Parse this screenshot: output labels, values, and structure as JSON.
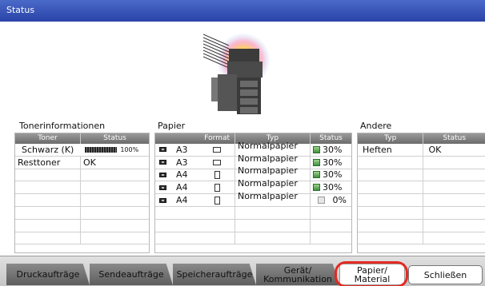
{
  "window": {
    "title": "Status"
  },
  "toner": {
    "label": "Tonerinformationen",
    "columns": [
      "Toner",
      "Status"
    ],
    "rows": [
      {
        "name": "Schwarz (K)",
        "percent": "100%",
        "level": 1.0
      },
      {
        "name": "Resttoner",
        "status": "OK"
      }
    ]
  },
  "paper": {
    "label": "Papier",
    "columns": [
      "Format",
      "Typ",
      "Status"
    ],
    "rows": [
      {
        "size": "A3",
        "type": "Normalpapier",
        "status": "30%"
      },
      {
        "size": "A3",
        "type": "Normalpapier",
        "status": "30%"
      },
      {
        "size": "A4",
        "type": "Normalpapier",
        "status": "30%"
      },
      {
        "size": "A4",
        "type": "Normalpapier",
        "status": "30%"
      },
      {
        "size": "A4",
        "type": "Normalpapier",
        "status": "0%"
      }
    ]
  },
  "other": {
    "label": "Andere",
    "columns": [
      "Typ",
      "Status"
    ],
    "rows": [
      {
        "type": "Heften",
        "status": "OK"
      }
    ]
  },
  "tabs": {
    "print_jobs": "Druckaufträge",
    "send_jobs": "Sendeaufträge",
    "storage_jobs": "Speicheraufträge",
    "device_line1": "Gerät/",
    "device_line2": "Kommunikation",
    "paper_line1": "Papier/",
    "paper_line2": "Material",
    "close": "Schließen"
  },
  "colors": {
    "title_bar": "#2f4bb0",
    "highlight": "#e32a23",
    "level_ok": "#4ea04a"
  }
}
